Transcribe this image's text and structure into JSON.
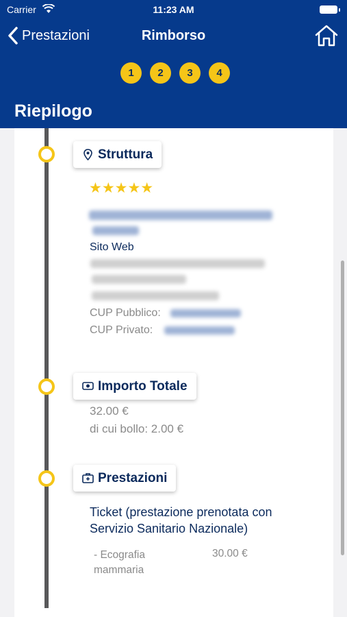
{
  "status_bar": {
    "carrier": "Carrier",
    "time": "11:23 AM"
  },
  "nav": {
    "back_label": "Prestazioni",
    "title": "Rimborso"
  },
  "steps": [
    "1",
    "2",
    "3",
    "4"
  ],
  "page_title": "Riepilogo",
  "struttura": {
    "label": "Struttura",
    "rating": "★★★★★",
    "website_label": "Sito Web",
    "cup_pubblico_label": "CUP Pubblico:",
    "cup_privato_label": "CUP Privato:"
  },
  "importo": {
    "label": "Importo Totale",
    "total": "32.00 €",
    "bollo": "di cui bollo: 2.00 €"
  },
  "prestazioni": {
    "label": "Prestazioni",
    "ticket_text": "Ticket (prestazione prenotata con Servizio Sanitario Nazionale)",
    "items": [
      {
        "name": "- Ecografia mammaria",
        "price": "30.00 €"
      }
    ]
  },
  "colors": {
    "header": "#063a8c",
    "accent": "#f5c518",
    "text_dark": "#0b2a5c"
  }
}
